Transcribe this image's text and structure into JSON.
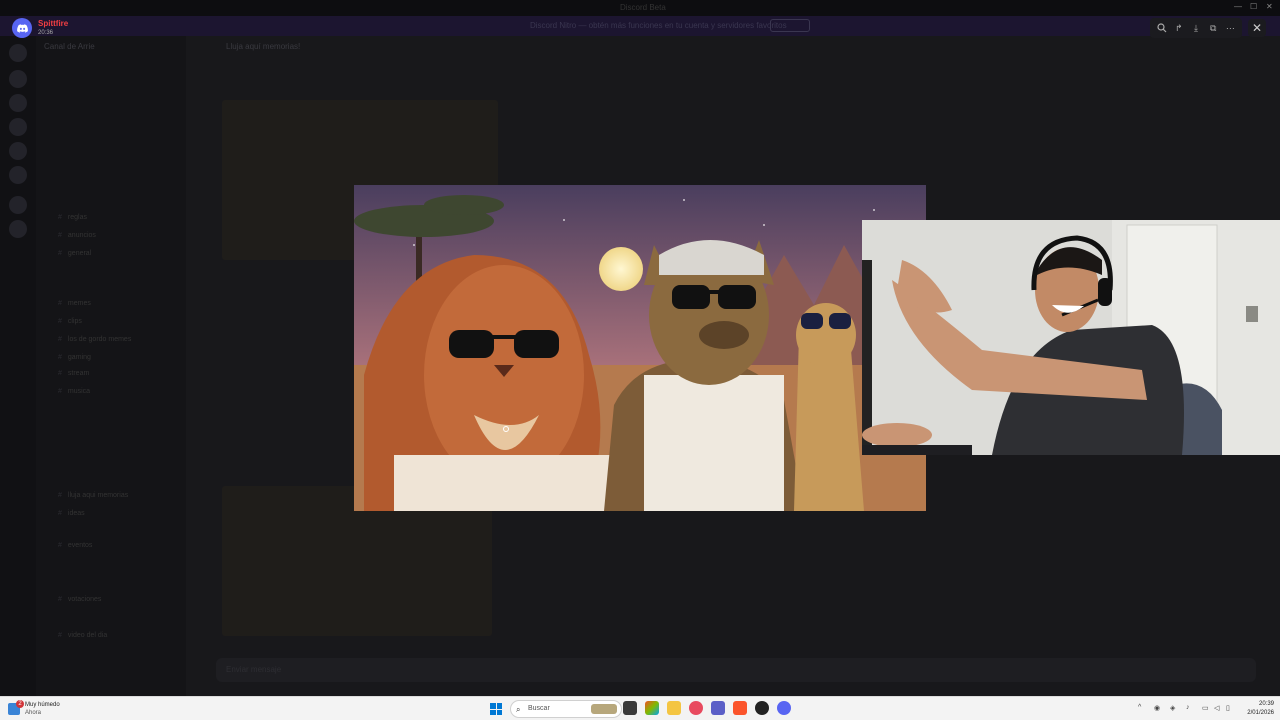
{
  "window": {
    "title": "Discord Beta"
  },
  "notification": {
    "app_name": "Spittfire",
    "time": "20:36",
    "icon": "discord-icon",
    "accent": "#5865f2"
  },
  "background_app": {
    "server_name": "Canal de Arrie",
    "channel_title": "Lluja aquí memorias!",
    "banner_text": "Discord Nitro — obtén más funciones en tu cuenta y servidores favoritos",
    "banner_cta": "Mejorar",
    "channels": [
      "reglas",
      "anuncios",
      "general",
      "memes",
      "clips",
      "los de gordo memes",
      "gaming",
      "stream",
      "musica",
      "lluja aqui memorias",
      "ideas",
      "eventos",
      "votaciones",
      "video del dia"
    ],
    "message_placeholder": "Enviar mensaje"
  },
  "viewer_toolbar": {
    "tools": [
      "zoom-icon",
      "share-icon",
      "download-icon",
      "open-external-icon",
      "more-icon"
    ],
    "close": "close-icon"
  },
  "image": {
    "description_icon": "meme-image",
    "colors": {
      "sky_top": "#4a3e5e",
      "sky_bottom": "#d9a079",
      "lion": "#c26a3a",
      "hyena": "#8b6a3f",
      "meerkat": "#c79a5a"
    }
  },
  "webcam": {
    "icon": "person-webcam"
  },
  "taskbar": {
    "weather_badge": "2",
    "weather_text": "Muy húmedo",
    "weather_sub": "Ahora",
    "search_placeholder": "Buscar",
    "apps": [
      "file-explorer-icon",
      "copilot-icon",
      "folder-icon",
      "store-icon",
      "app-icon",
      "teams-icon",
      "brave-icon",
      "obs-icon",
      "discord-icon"
    ],
    "time": "20:39",
    "date": "2/01/2026"
  }
}
